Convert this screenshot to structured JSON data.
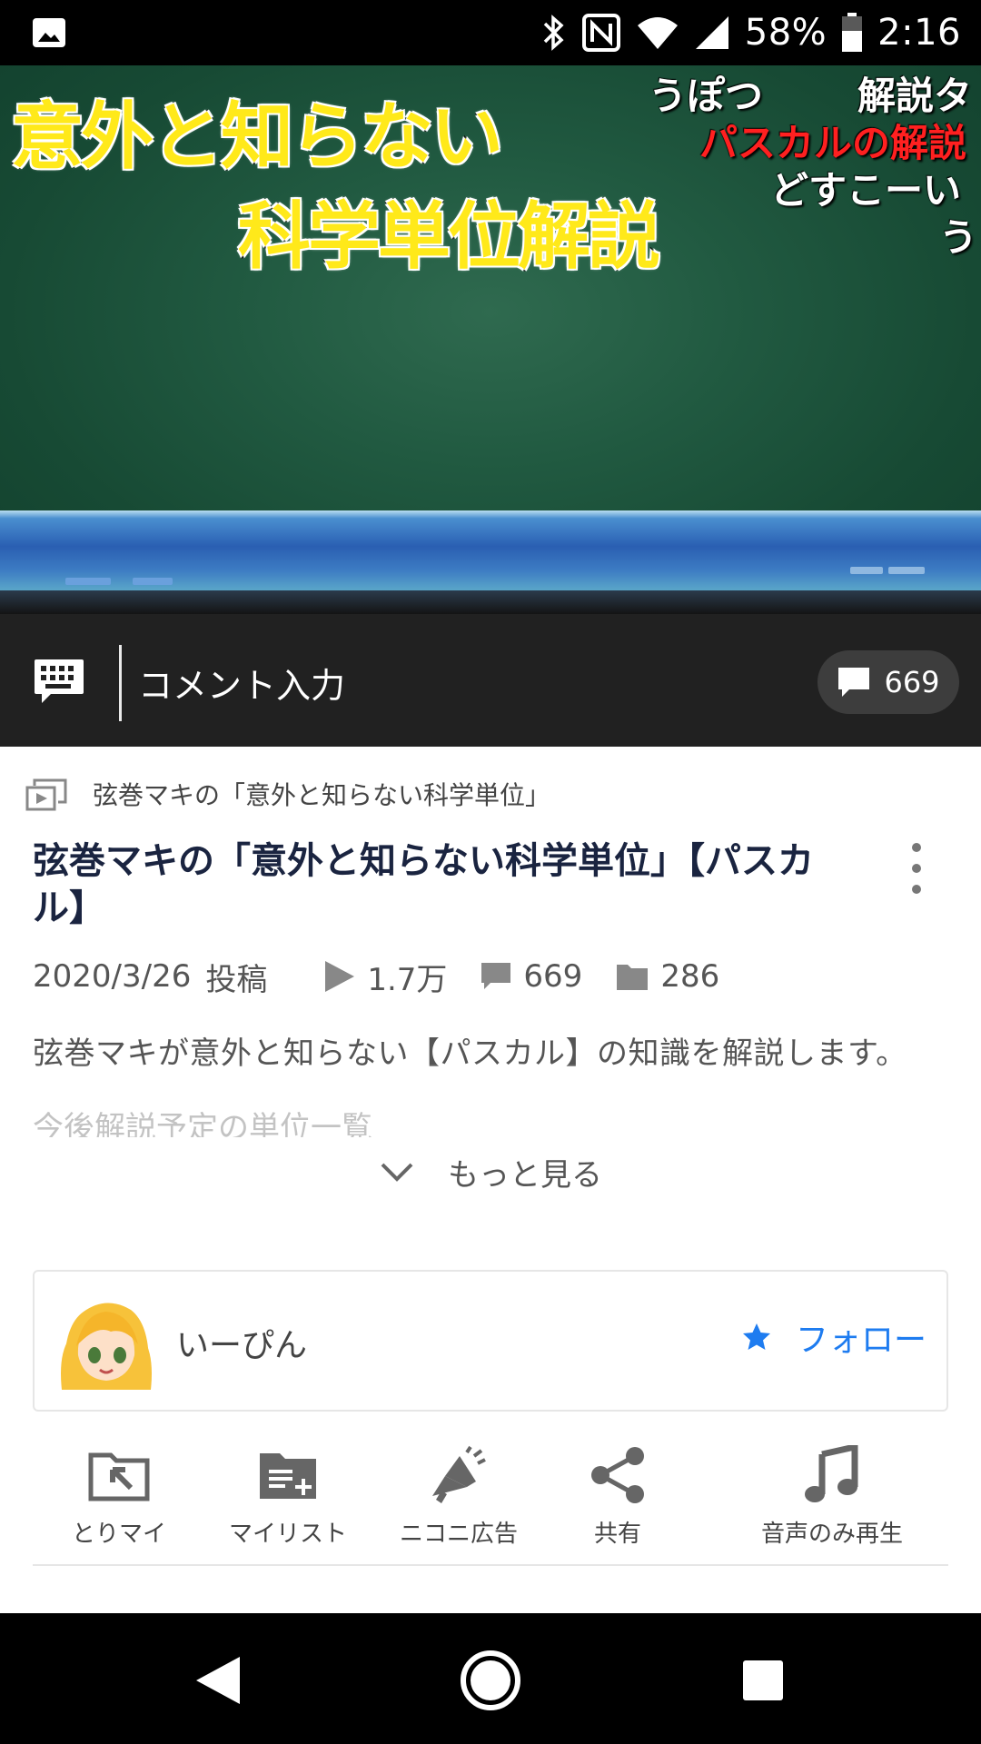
{
  "status_bar": {
    "battery": "58%",
    "time": "2:16",
    "icons": [
      "gallery-icon",
      "bluetooth-icon",
      "nfc-icon",
      "wifi-icon",
      "signal-icon",
      "battery-icon"
    ]
  },
  "video": {
    "title_line1": "意外と知らない",
    "title_line2": "科学単位解説",
    "comments_overlay": [
      "うぽつ",
      "解説タ",
      "パスカルの解説",
      "どすこーい",
      "う"
    ]
  },
  "comment_bar": {
    "placeholder": "コメント入力",
    "count": "669"
  },
  "series": {
    "name": "弦巻マキの「意外と知らない科学単位」"
  },
  "video_info": {
    "title": "弦巻マキの「意外と知らない科学単位」【パスカル】",
    "date": "2020/3/26",
    "posted_label": "投稿",
    "views": "1.7万",
    "comments": "669",
    "mylists": "286",
    "description_line1": "弦巻マキが意外と知らない【パスカル】の知識を解説します。",
    "description_line2": "今後解説予定の単位一覧",
    "more_label": "もっと見る"
  },
  "uploader": {
    "name": "いーぴん",
    "follow_label": "フォロー"
  },
  "actions": [
    {
      "label": "とりマイ",
      "icon": "folder-pin-icon"
    },
    {
      "label": "マイリスト",
      "icon": "mylist-add-icon"
    },
    {
      "label": "ニコニ広告",
      "icon": "megaphone-icon"
    },
    {
      "label": "共有",
      "icon": "share-icon"
    },
    {
      "label": "音声のみ再生",
      "icon": "music-note-icon"
    }
  ],
  "colors": {
    "accent_blue": "#1e7cf0",
    "title_yellow": "#ffe91a",
    "comment_red": "#ff2020",
    "dark_bar": "#212121"
  }
}
